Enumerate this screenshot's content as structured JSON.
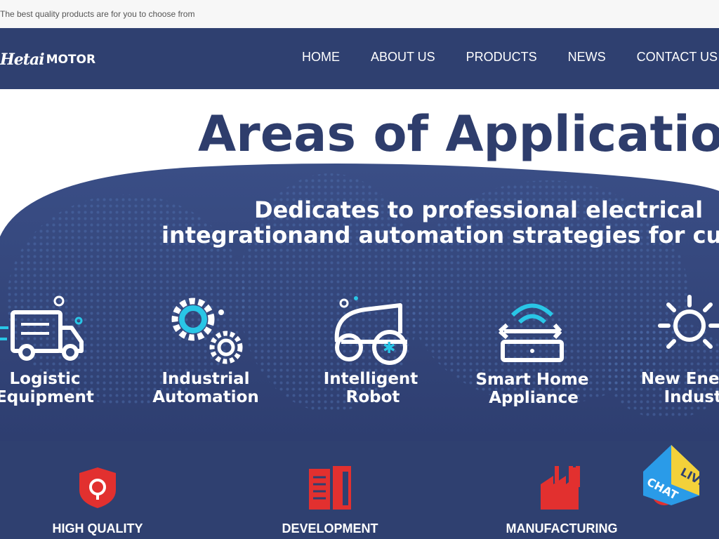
{
  "tagline": "The best quality products are for you to choose from",
  "logo": {
    "script": "Hetai",
    "word": "MOTOR"
  },
  "nav": [
    "HOME",
    "ABOUT US",
    "PRODUCTS",
    "NEWS",
    "CONTACT US"
  ],
  "banner": {
    "title": "Areas of Application",
    "subtitle_line1": "Dedicates to professional electrical",
    "subtitle_line2": "integrationand automation strategies for customers",
    "areas": [
      {
        "line1": "Logistic",
        "line2": "Equipment"
      },
      {
        "line1": "Industrial",
        "line2": "Automation"
      },
      {
        "line1": "Intelligent",
        "line2": "Robot"
      },
      {
        "line1": "Smart Home",
        "line2": "Appliance"
      },
      {
        "line1": "New Energy",
        "line2": "Industry"
      }
    ]
  },
  "features": [
    "HIGH QUALITY",
    "DEVELOPMENT",
    "MANUFACTURING"
  ],
  "live_chat": {
    "line1": "LIVE",
    "line2": "CHAT"
  },
  "colors": {
    "header": "#2f4070",
    "accent_red": "#e2302f",
    "cyan": "#29c6e6",
    "title_navy": "#2e3d6c"
  }
}
